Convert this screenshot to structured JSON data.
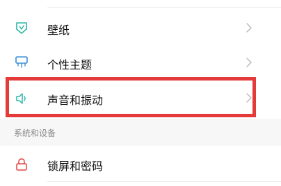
{
  "settings": {
    "rows": [
      {
        "label": "壁纸",
        "icon": "wallpaper-icon",
        "has_chevron": true
      },
      {
        "label": "个性主题",
        "icon": "theme-icon",
        "has_chevron": true
      },
      {
        "label": "声音和振动",
        "icon": "speaker-icon",
        "has_chevron": true
      }
    ],
    "section_header": "系统和设备",
    "section_rows": [
      {
        "label": "锁屏和密码",
        "icon": "lock-icon",
        "has_chevron": false
      }
    ]
  },
  "colors": {
    "accent_teal": "#2bb5a8",
    "accent_blue": "#3b8ed8",
    "accent_lock": "#e64545",
    "highlight_box": "#e43a3a"
  }
}
